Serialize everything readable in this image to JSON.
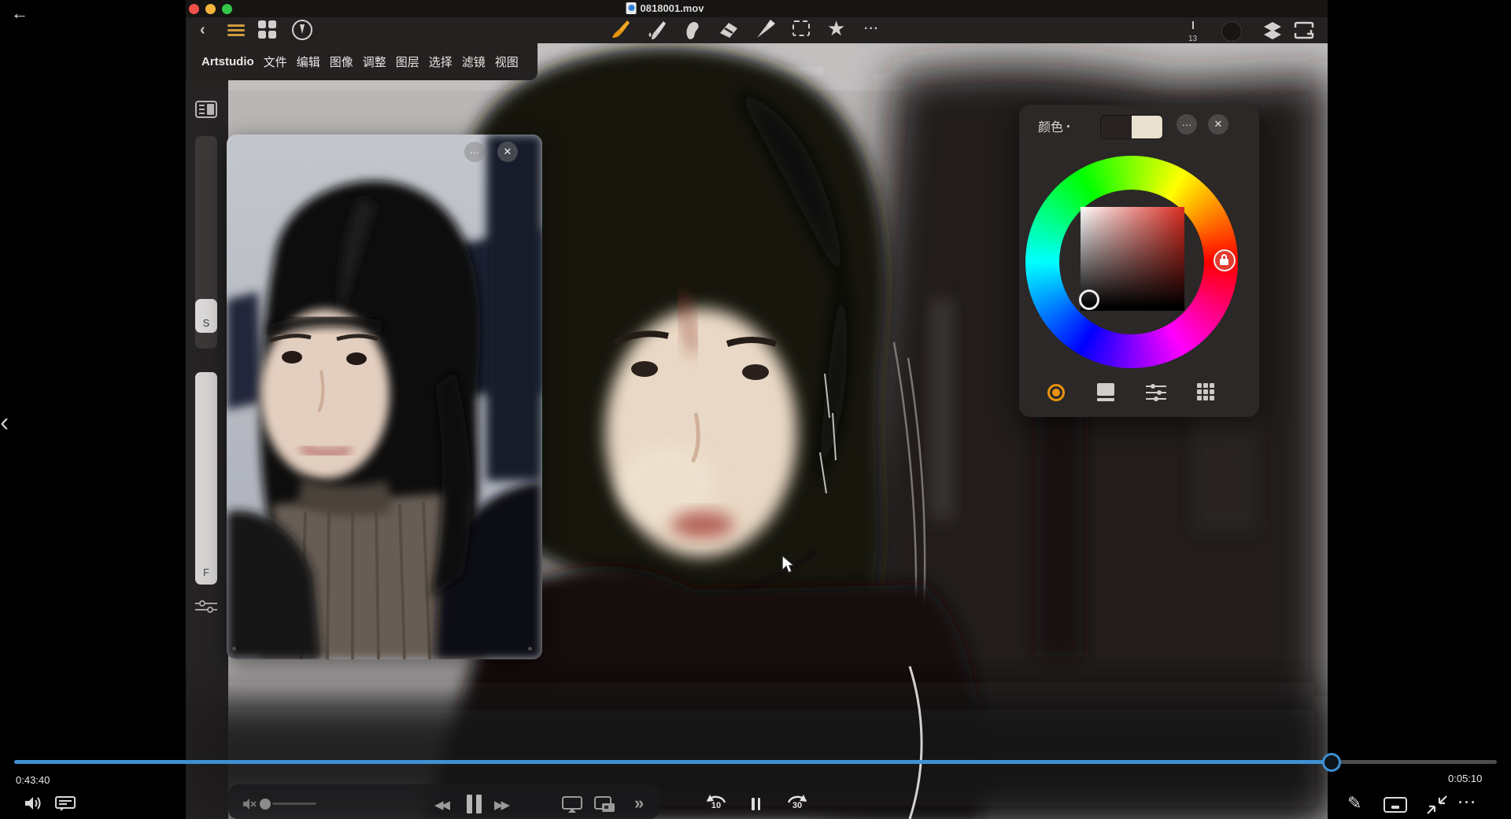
{
  "player": {
    "window_title": "0818001.mov",
    "time_elapsed": "0:43:40",
    "time_remaining": "0:05:10",
    "progress_percent": 88,
    "skip_back_seconds": "10",
    "skip_forward_seconds": "30",
    "fast_chevrons": "»",
    "more_label": "···",
    "accent_blue": "#3f8fd2"
  },
  "app": {
    "menu_items": [
      "Artstudio",
      "文件",
      "编辑",
      "图像",
      "调整",
      "图层",
      "选择",
      "滤镜",
      "视图"
    ],
    "tools": [
      "paint-brush",
      "wet-brush",
      "smudge",
      "eraser",
      "color-picker",
      "selection-marquee",
      "favorites-star",
      "more"
    ],
    "selected_tool": "paint-brush",
    "brush_accent": "#e8940f",
    "brush_size": "13",
    "star_glyph": "★",
    "toolbar_more": "···",
    "sliders": {
      "size_label": "S",
      "flow_label": "F"
    }
  },
  "reference_window": {
    "more_label": "···",
    "close_label": "✕"
  },
  "color_panel": {
    "title": "颜色",
    "title_dot": "•",
    "primary_color": "#282322",
    "secondary_color": "#e9e1cf",
    "more_label": "···",
    "close_label": "✕",
    "tabs": [
      "wheel",
      "swatch",
      "sliders",
      "palette"
    ],
    "selected_tab": "wheel"
  }
}
